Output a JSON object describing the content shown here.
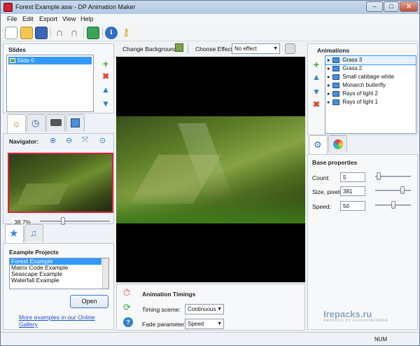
{
  "window": {
    "title": "Forest Example.asw - DP Animation Maker",
    "min": "–",
    "max": "□",
    "close": "✕"
  },
  "menu": [
    "File",
    "Edit",
    "Export",
    "View",
    "Help"
  ],
  "toolbar_icons": [
    "new-icon",
    "open-icon",
    "save-icon",
    "undo-icon",
    "redo-icon",
    "export-icon",
    "info-icon",
    "key-icon"
  ],
  "slides": {
    "header": "Slides",
    "items": [
      "Slide 0"
    ]
  },
  "navigator": {
    "label": "Navigator:",
    "zoom": "38.7%"
  },
  "example_projects": {
    "header": "Example Projects",
    "items": [
      "Forest Example",
      "Matrix Code Example",
      "Seascape Example",
      "Waterfall Example"
    ],
    "open_label": "Open",
    "gallery_link": "More examples in our Online Gallery"
  },
  "center": {
    "change_background": "Change Background",
    "choose_effect_label": "Choose Effect:",
    "effect_value": "No effect"
  },
  "timings": {
    "header": "Animation Timings",
    "timing_scheme_label": "Timing sceme:",
    "timing_scheme_value": "Continuous",
    "fade_label": "Fade parameter:",
    "fade_value": "Speed"
  },
  "animations": {
    "header": "Animations",
    "items": [
      "Grass 3",
      "Grass 2",
      "Small cabbage white",
      "Monarch butterfly",
      "Rays of light 2",
      "Rays of light 1"
    ]
  },
  "base_properties": {
    "header": "Base properties",
    "count_label": "Count:",
    "count_value": "5",
    "count_level": 0.05,
    "size_label": "Size, pixels:",
    "size_value": "381",
    "size_level": 0.8,
    "speed_label": "Speed:",
    "speed_value": "50",
    "speed_level": 0.5
  },
  "status": {
    "num": "NUM"
  },
  "watermark": {
    "site": "Irepacks.ru",
    "sub": "REPACKS BY ELCHUPACABRA"
  },
  "colors": {
    "accent": "#3399ff",
    "selection": "#3399ff"
  }
}
